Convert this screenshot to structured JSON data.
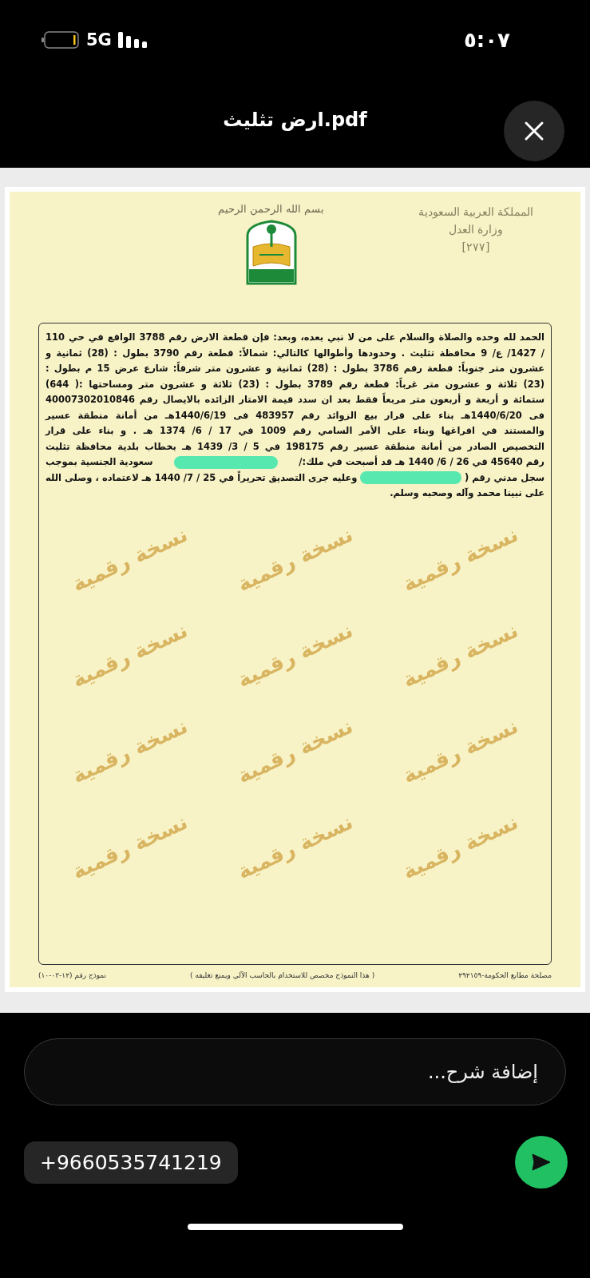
{
  "status_bar": {
    "time": "٥:٠٧",
    "network": "5G"
  },
  "header": {
    "title": "ارض تثليث.pdf"
  },
  "document": {
    "header_right": [
      "المملكة العربية السعودية",
      "وزارة العدل",
      "[٢٧٧]"
    ],
    "basmala": "بسم الله الرحمن الرحيم",
    "lines": [
      [
        {
          "kind": "text",
          "text": "الحمد لله وحده والصلاة والسلام على من لا نبي بعده، وبعد: فإن قطعة الارض رقم 3788 الواقع في حي 110"
        }
      ],
      [
        {
          "kind": "text",
          "text": "/ 1427/ ع/ 9 محافظة تثليث . وحدودها وأطوالها كالتالي: شمالاً: قطعة رقم 3790 بطول : (28) ثمانية و"
        }
      ],
      [
        {
          "kind": "text",
          "text": "عشرون متر جنوباً: قطعة رقم 3786 بطول : (28) ثمانية و عشرون متر شرقاً: شارع عرض 15 م بطول :"
        }
      ],
      [
        {
          "kind": "text",
          "text": "(23) ثلاثة و عشرون متر غرباً: قطعة رقم 3789 بطول : (23) ثلاثة و عشرون متر ومساحتها :( 644)"
        }
      ],
      [
        {
          "kind": "text",
          "text": "ستمائة و أربعة و أربعون متر مربعاً فقط بعد ان سدد قيمة الامتار الزائده بالايصال رقم 40007302010846"
        }
      ],
      [
        {
          "kind": "text",
          "text": "فى 1440/6/20هـ بناء على قرار بيع الزوائد رقم 483957 فى 1440/6/19هـ من أمانة منطقة عسير"
        }
      ],
      [
        {
          "kind": "text",
          "text": "والمستند في افراغها وبناء على الأمر السامي رقم 1009 في 17 / 6/ 1374 هـ . و بناء على قرار"
        }
      ],
      [
        {
          "kind": "text",
          "text": "التخصيص الصادر من أمانة منطقة عسير رقم 198175 في 5 / 3/ 1439 هـ بخطاب بلدية محافظة تثليث"
        }
      ],
      [
        {
          "kind": "text",
          "text": "رقم 45640 في 26 / 6/ 1440 هـ قد أصبحت في ملك:/"
        },
        {
          "kind": "redacted"
        },
        {
          "kind": "text",
          "text": "سعودية الجنسية بموجب"
        }
      ],
      [
        {
          "kind": "text",
          "text": "سجل مدني رقم ("
        },
        {
          "kind": "redacted"
        },
        {
          "kind": "text",
          "text": "وعليه جرى التصديق تحريراً في 25 / 7/ 1440 هـ لاعتماده ، وصلى الله"
        }
      ],
      [
        {
          "kind": "text",
          "text": "على نبينا محمد وآله وصحبه وسلم."
        }
      ]
    ],
    "stamps": [
      "نسخة رقمية",
      "نسخة رقمية",
      "نسخة رقمية",
      "نسخة رقمية",
      "نسخة رقمية",
      "نسخة رقمية",
      "نسخة رقمية",
      "نسخة رقمية",
      "نسخة رقمية",
      "نسخة رقمية",
      "نسخة رقمية",
      "نسخة رقمية"
    ],
    "footer": [
      "مصلحة مطابع الحكومة-٢٩٢١٥٩",
      "( هذا النموذج مخصص للاستخدام بالحاسب الآلي ويمنع تغليفه )",
      "نموذج رقم (١٢-٠٣-١٠)"
    ]
  },
  "caption": {
    "placeholder": "إضافة شرح..."
  },
  "recipient": "+9660535741219"
}
